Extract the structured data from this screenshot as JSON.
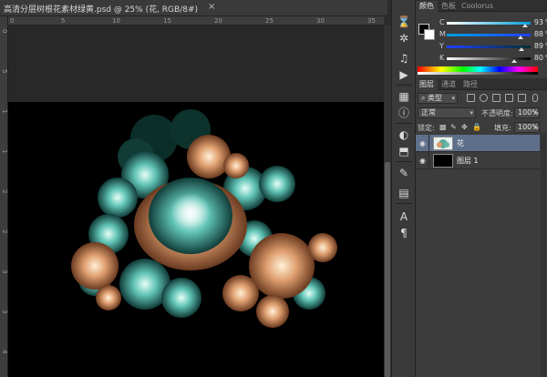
{
  "document": {
    "tab_title": "高清分层树根花素材绿黄.psd @ 25% (花, RGB/8#)",
    "close_glyph": "×"
  },
  "rulers": {
    "top_ticks": [
      "0",
      "5",
      "10",
      "15",
      "20",
      "25",
      "30",
      "35"
    ],
    "left_ticks": [
      "0",
      "5",
      "1",
      "1",
      "2",
      "2",
      "3",
      "3",
      "4"
    ]
  },
  "color_panel": {
    "tabs": [
      "颜色",
      "色板",
      "Coolorus"
    ],
    "active_tab": 0,
    "channels": [
      {
        "label": "C",
        "value": "93",
        "unit": "%",
        "fraction": 0.93,
        "gradient": [
          "#ffffff",
          "#00a0e0"
        ]
      },
      {
        "label": "M",
        "value": "88",
        "unit": "%",
        "fraction": 0.88,
        "gradient": [
          "#00a0e0",
          "#2040ff"
        ]
      },
      {
        "label": "Y",
        "value": "89",
        "unit": "%",
        "fraction": 0.89,
        "gradient": [
          "#2040ff",
          "#003030"
        ]
      },
      {
        "label": "K",
        "value": "80",
        "unit": "%",
        "fraction": 0.8,
        "gradient": [
          "#ffffff",
          "#000000"
        ]
      }
    ],
    "foreground": "#000000",
    "background": "#ffffff"
  },
  "layers_panel": {
    "tabs": [
      "图层",
      "通道",
      "路径"
    ],
    "active_tab": 0,
    "filter_kind": "类型",
    "blend_mode": "正常",
    "opacity_label": "不透明度:",
    "opacity_value": "100%",
    "lock_label": "锁定:",
    "fill_label": "填充:",
    "fill_value": "100%",
    "layers": [
      {
        "name": "花",
        "selected": true
      },
      {
        "name": "图层 1",
        "selected": false
      }
    ]
  },
  "tool_strip": {
    "icons": [
      "history-icon",
      "brush-settings-icon",
      "properties-icon",
      "actions-icon",
      "info-icon",
      "navigator-icon",
      "adjustments-icon",
      "styles-icon",
      "clone-source-icon",
      "tool-presets-icon",
      "character-icon",
      "paragraph-icon"
    ]
  }
}
